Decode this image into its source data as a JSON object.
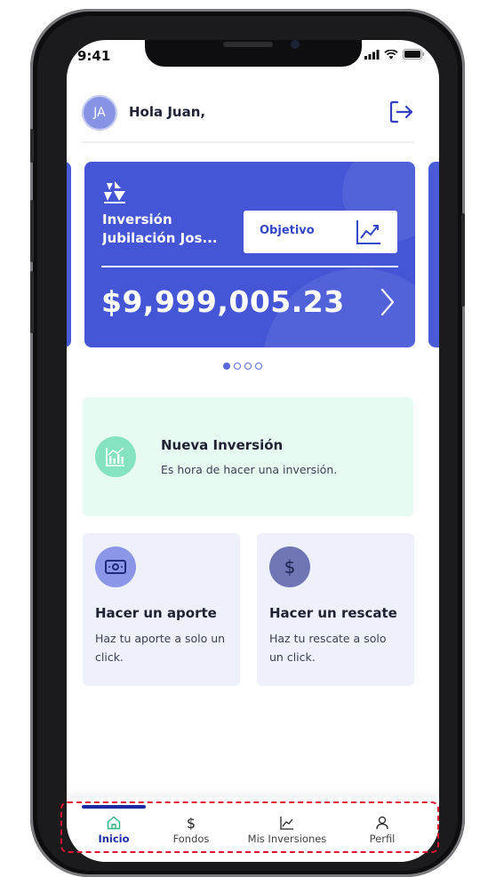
{
  "status_bar": {
    "time": "9:41"
  },
  "header": {
    "avatar_initials": "JA",
    "greeting": "Hola Juan,"
  },
  "investment_card": {
    "title_line1": "Inversión",
    "title_line2": "Jubilación Jos...",
    "objective_label": "Objetivo",
    "amount": "$9,999,005.23"
  },
  "carousel": {
    "count": 4,
    "active": 1
  },
  "promo": {
    "title": "Nueva Inversión",
    "subtitle": "Es hora de hacer una inversión."
  },
  "actions": [
    {
      "title": "Hacer un aporte",
      "subtitle": "Haz tu aporte a solo un click.",
      "icon": "money-icon",
      "icon_bg": "#8b97e6"
    },
    {
      "title": "Hacer un rescate",
      "subtitle": "Haz tu rescate a solo un click.",
      "icon": "dollar-icon",
      "icon_bg": "#6f76b3"
    }
  ],
  "tabs": [
    {
      "label": "Inicio",
      "icon": "home-icon",
      "active": true
    },
    {
      "label": "Fondos",
      "icon": "dollar-icon",
      "active": false
    },
    {
      "label": "Mis Inversiones",
      "icon": "chart-icon",
      "active": false
    },
    {
      "label": "Perfil",
      "icon": "user-icon",
      "active": false
    }
  ],
  "colors": {
    "primary": "#4455d6",
    "accent_dark": "#1b2aa6",
    "promo_bg": "#e8fbf3",
    "action_bg": "#eef1fb",
    "highlight": "#e0142e"
  }
}
